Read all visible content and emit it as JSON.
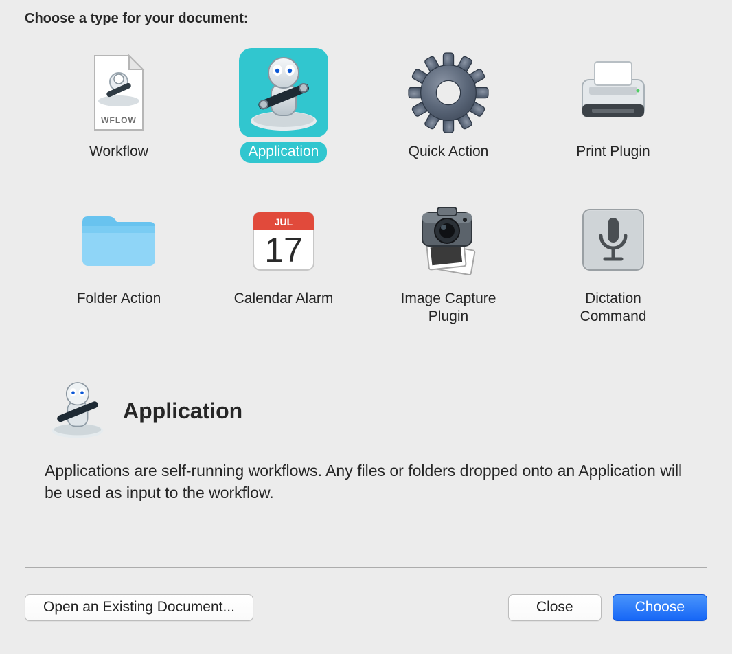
{
  "heading": "Choose a type for your document:",
  "types": [
    {
      "id": "workflow",
      "label": "Workflow",
      "icon": "wflow-document-icon"
    },
    {
      "id": "application",
      "label": "Application",
      "icon": "automator-app-icon"
    },
    {
      "id": "quick-action",
      "label": "Quick Action",
      "icon": "gear-icon"
    },
    {
      "id": "print-plugin",
      "label": "Print Plugin",
      "icon": "printer-icon"
    },
    {
      "id": "folder-action",
      "label": "Folder Action",
      "icon": "folder-icon"
    },
    {
      "id": "calendar-alarm",
      "label": "Calendar Alarm",
      "icon": "calendar-icon",
      "calendar_month": "JUL",
      "calendar_day": "17"
    },
    {
      "id": "image-capture-plugin",
      "label": "Image Capture Plugin",
      "icon": "camera-icon"
    },
    {
      "id": "dictation-command",
      "label": "Dictation Command",
      "icon": "microphone-icon"
    }
  ],
  "selected_index": 1,
  "description": {
    "title": "Application",
    "body": "Applications are self-running workflows. Any files or folders dropped onto an Application will be used as input to the workflow."
  },
  "buttons": {
    "open_existing": "Open an Existing Document...",
    "close": "Close",
    "choose": "Choose"
  }
}
